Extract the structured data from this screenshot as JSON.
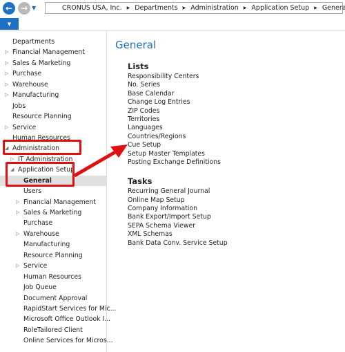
{
  "breadcrumb": [
    "CRONUS USA, Inc.",
    "Departments",
    "Administration",
    "Application Setup",
    "General"
  ],
  "nav": {
    "back_icon": "arrow-left",
    "forward_icon": "arrow-right",
    "history_icon": "caret-down",
    "menu_icon": "caret-down"
  },
  "sidebar": {
    "items": [
      {
        "label": "Departments",
        "level": 0,
        "state": "none"
      },
      {
        "label": "Financial Management",
        "level": 0,
        "state": "collapsed"
      },
      {
        "label": "Sales & Marketing",
        "level": 0,
        "state": "collapsed"
      },
      {
        "label": "Purchase",
        "level": 0,
        "state": "collapsed"
      },
      {
        "label": "Warehouse",
        "level": 0,
        "state": "collapsed"
      },
      {
        "label": "Manufacturing",
        "level": 0,
        "state": "collapsed"
      },
      {
        "label": "Jobs",
        "level": 0,
        "state": "none"
      },
      {
        "label": "Resource Planning",
        "level": 0,
        "state": "none"
      },
      {
        "label": "Service",
        "level": 0,
        "state": "collapsed"
      },
      {
        "label": "Human Resources",
        "level": 0,
        "state": "none"
      },
      {
        "label": "Administration",
        "level": 0,
        "state": "expanded"
      },
      {
        "label": "IT Administration",
        "level": 1,
        "state": "collapsed"
      },
      {
        "label": "Application Setup",
        "level": 1,
        "state": "expanded"
      },
      {
        "label": "General",
        "level": 2,
        "state": "none",
        "selected": true
      },
      {
        "label": "Users",
        "level": 2,
        "state": "none"
      },
      {
        "label": "Financial Management",
        "level": 2,
        "state": "collapsed"
      },
      {
        "label": "Sales & Marketing",
        "level": 2,
        "state": "collapsed"
      },
      {
        "label": "Purchase",
        "level": 2,
        "state": "none"
      },
      {
        "label": "Warehouse",
        "level": 2,
        "state": "collapsed"
      },
      {
        "label": "Manufacturing",
        "level": 2,
        "state": "none"
      },
      {
        "label": "Resource Planning",
        "level": 2,
        "state": "none"
      },
      {
        "label": "Service",
        "level": 2,
        "state": "collapsed"
      },
      {
        "label": "Human Resources",
        "level": 2,
        "state": "none"
      },
      {
        "label": "Job Queue",
        "level": 2,
        "state": "none"
      },
      {
        "label": "Document Approval",
        "level": 2,
        "state": "none"
      },
      {
        "label": "RapidStart Services for Mic...",
        "level": 2,
        "state": "none"
      },
      {
        "label": "Microsoft Office Outlook I...",
        "level": 2,
        "state": "none"
      },
      {
        "label": "RoleTailored Client",
        "level": 2,
        "state": "none"
      },
      {
        "label": "Online Services for Micros...",
        "level": 2,
        "state": "none"
      }
    ]
  },
  "main": {
    "title": "General",
    "lists_heading": "Lists",
    "lists": [
      "Responsibility Centers",
      "No. Series",
      "Base Calendar",
      "Change Log Entries",
      "ZIP Codes",
      "Territories",
      "Languages",
      "Countries/Regions",
      "Cue Setup",
      "Setup Master Templates",
      "Posting Exchange Definitions"
    ],
    "tasks_heading": "Tasks",
    "tasks": [
      "Recurring General Journal",
      "Online Map Setup",
      "Company Information",
      "Bank Export/Import Setup",
      "SEPA Schema Viewer",
      "XML Schemas",
      "Bank Data Conv. Service Setup"
    ]
  },
  "annotation_color": "#e01010",
  "accent_color": "#1f6fc5"
}
